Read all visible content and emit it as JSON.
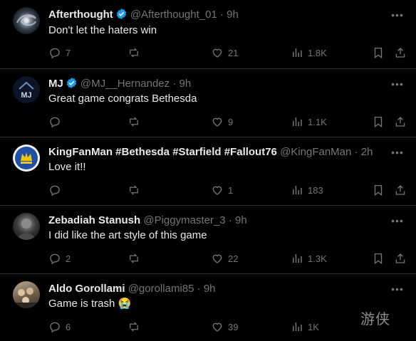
{
  "tweets": [
    {
      "name": "Afterthought",
      "verified": true,
      "handle": "@Afterthought_01",
      "time": "9h",
      "text": "Don't let the haters win",
      "replies": "7",
      "reposts": "",
      "likes": "21",
      "views": "1.8K"
    },
    {
      "name": "MJ",
      "verified": true,
      "handle": "@MJ__Hernandez",
      "time": "9h",
      "text": "Great game congrats Bethesda",
      "replies": "",
      "reposts": "",
      "likes": "9",
      "views": "1.1K"
    },
    {
      "name": "KingFanMan #Bethesda #Starfield #Fallout76",
      "verified": false,
      "handle": "@KingFanMan",
      "time": "2h",
      "text": "Love it!!",
      "replies": "",
      "reposts": "",
      "likes": "1",
      "views": "183"
    },
    {
      "name": "Zebadiah Stanush",
      "verified": false,
      "handle": "@Piggymaster_3",
      "time": "9h",
      "text": "I did like the art style of this game",
      "replies": "2",
      "reposts": "",
      "likes": "22",
      "views": "1.3K"
    },
    {
      "name": "Aldo Gorollami",
      "verified": false,
      "handle": "@gorollami85",
      "time": "9h",
      "text": "Game is trash 😭",
      "replies": "6",
      "reposts": "",
      "likes": "39",
      "views": "1K"
    }
  ],
  "separator": "·",
  "more_glyph": "•••",
  "watermark": "游侠",
  "colors": {
    "background": "#000000",
    "text": "#e7e9ea",
    "muted": "#71767b",
    "verified": "#1d9bf0",
    "divider": "#2f3336"
  },
  "icons": [
    "reply-icon",
    "repost-icon",
    "like-icon",
    "views-icon",
    "bookmark-icon",
    "share-icon",
    "verified-badge-icon",
    "more-icon"
  ]
}
